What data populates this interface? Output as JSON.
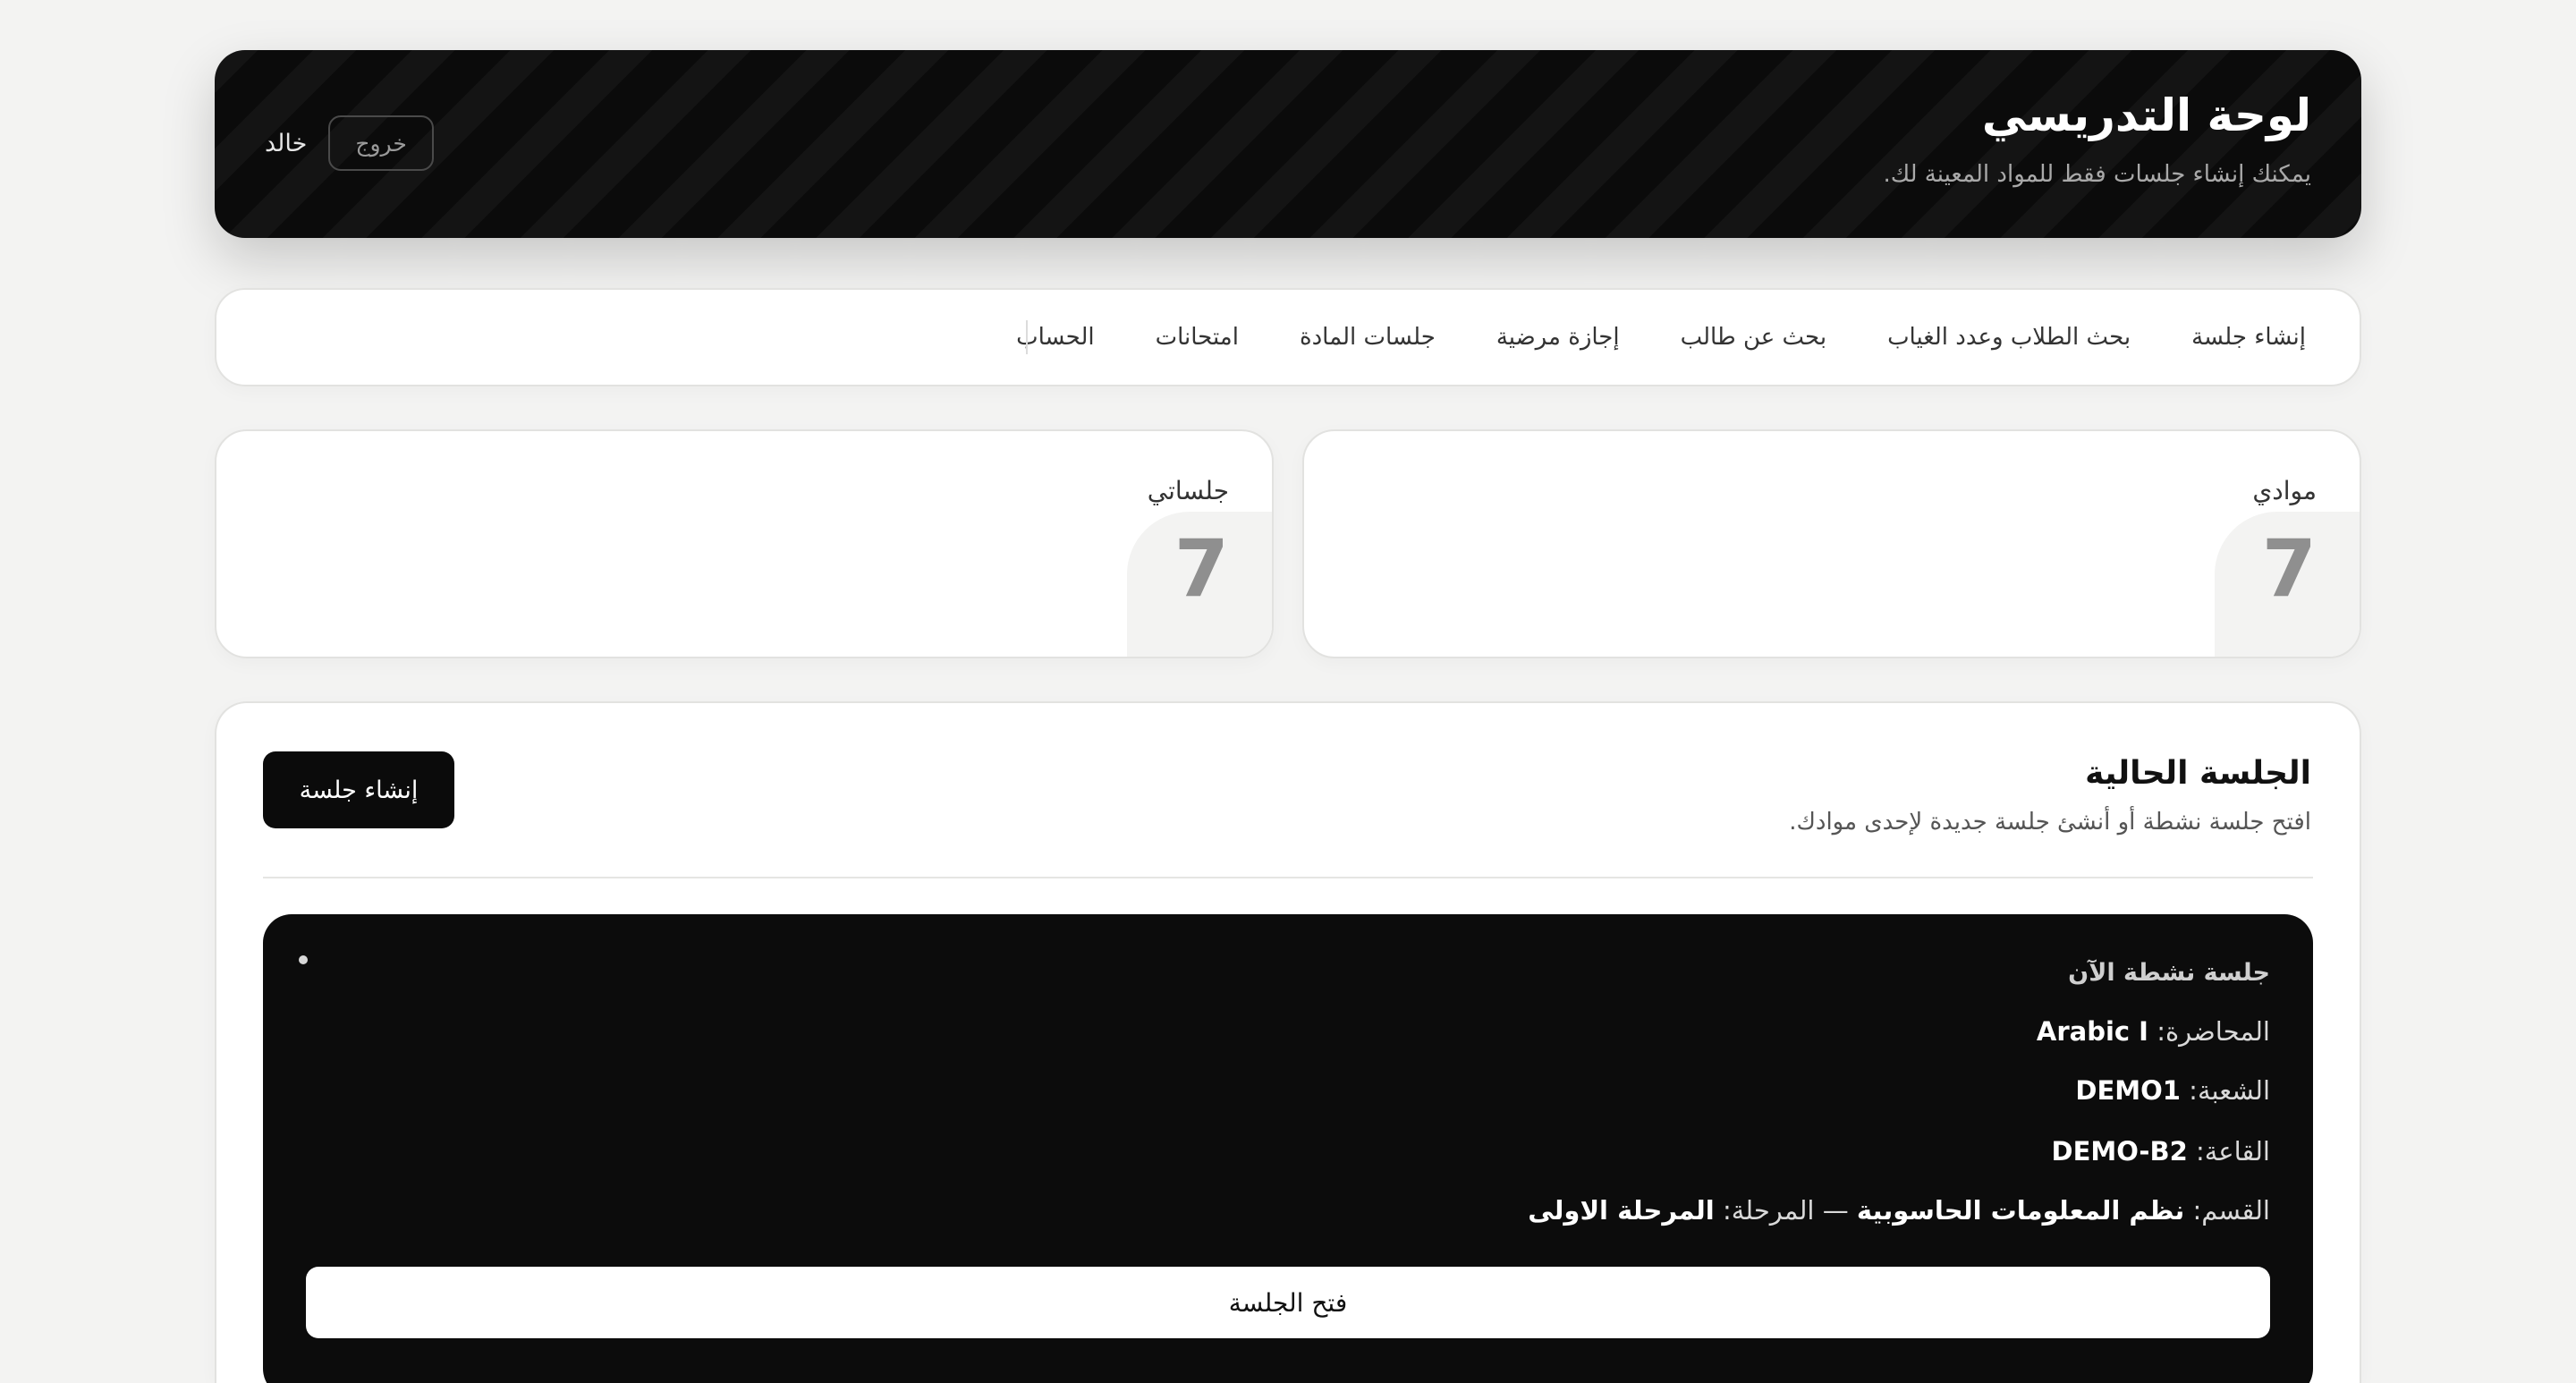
{
  "header": {
    "title": "لوحة التدريسي",
    "subtitle": "يمكنك إنشاء جلسات فقط للمواد المعينة لك.",
    "user_name": "خالد",
    "logout_label": "خروج"
  },
  "nav": {
    "items": [
      {
        "label": "إنشاء جلسة"
      },
      {
        "label": "بحث الطلاب وعدد الغياب"
      },
      {
        "label": "بحث عن طالب"
      },
      {
        "label": "إجازة مرضية"
      },
      {
        "label": "جلسات المادة"
      },
      {
        "label": "امتحانات"
      },
      {
        "label": "الحساب"
      }
    ]
  },
  "stats": {
    "subjects": {
      "label": "موادي",
      "value": "7"
    },
    "sessions": {
      "label": "جلساتي",
      "value": "7"
    }
  },
  "current_session": {
    "title": "الجلسة الحالية",
    "subtitle": "افتح جلسة نشطة أو أنشئ جلسة جديدة لإحدى موادك.",
    "create_label": "إنشاء جلسة",
    "active": {
      "status_label": "جلسة نشطة الآن",
      "lecture_label": "المحاضرة:",
      "lecture_value": "Arabic I",
      "section_label": "الشعبة:",
      "section_value": "DEMO1",
      "hall_label": "القاعة:",
      "hall_value": "DEMO-B2",
      "dept_label": "القسم:",
      "dept_value": "نظم المعلومات الحاسوبية",
      "dept_separator": "—",
      "stage_label": "المرحلة:",
      "stage_value": "المرحلة الاولى",
      "open_label": "فتح الجلسة"
    }
  }
}
